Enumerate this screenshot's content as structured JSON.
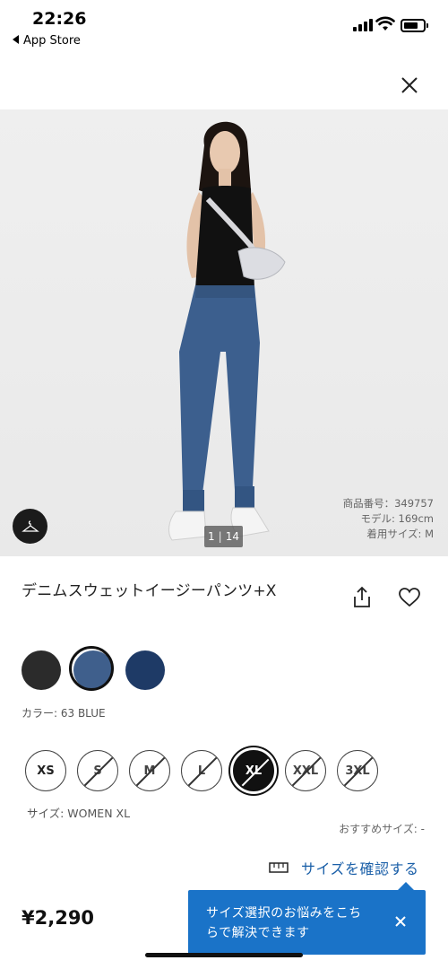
{
  "status_bar": {
    "time": "22:26",
    "back_app": "App Store"
  },
  "hero": {
    "current_image": "1",
    "total_images": "14",
    "meta_lines": [
      "商品番号：349757",
      "モデル: 169cm",
      "着用サイズ: M"
    ]
  },
  "product": {
    "title": "デニムスウェットイージーパンツ+X",
    "colors": [
      {
        "name": "black",
        "hex": "#2b2b2b",
        "selected": false
      },
      {
        "name": "63 BLUE",
        "hex": "#3f5f8c",
        "selected": true
      },
      {
        "name": "navy",
        "hex": "#1e3a66",
        "selected": false
      }
    ],
    "color_label": "カラー: 63 BLUE",
    "sizes": [
      {
        "label": "XS",
        "state": "available"
      },
      {
        "label": "S",
        "state": "unavailable"
      },
      {
        "label": "M",
        "state": "unavailable"
      },
      {
        "label": "L",
        "state": "unavailable"
      },
      {
        "label": "XL",
        "state": "selected"
      },
      {
        "label": "XXL",
        "state": "unavailable"
      },
      {
        "label": "3XL",
        "state": "unavailable"
      }
    ],
    "size_label": "サイズ: WOMEN XL",
    "recommend_label": "おすすめサイズ: -",
    "size_check_label": "サイズを確認する",
    "price": "¥2,290"
  },
  "tooltip": {
    "message_line1": "サイズ選択のお悩みをこち",
    "message_line2": "らで解決できます"
  },
  "colors": {
    "accent_blue": "#1a73c8",
    "link_blue": "#1a5fa8"
  }
}
